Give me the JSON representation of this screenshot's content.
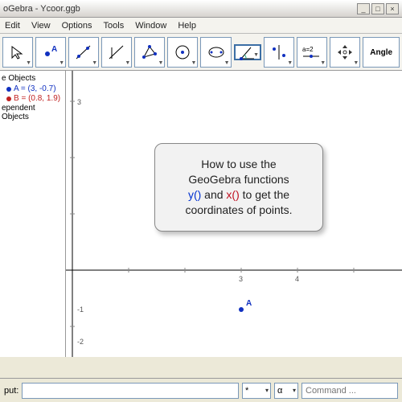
{
  "window": {
    "title": "oGebra - Ycoor.ggb"
  },
  "menu": {
    "edit": "Edit",
    "view": "View",
    "options": "Options",
    "tools": "Tools",
    "window": "Window",
    "help": "Help"
  },
  "toolbar": {
    "angle": "Angle"
  },
  "algebra": {
    "free_header": "e Objects",
    "objA": "A = (3, -0.7)",
    "objB": "B = (0.8, 1.9)",
    "dep_header": "ependent Objects"
  },
  "tooltip": {
    "l1": "How to use the",
    "l2": "GeoGebra functions",
    "yfn": "y()",
    "and": " and ",
    "xfn": "x()",
    "l3b": " to get the",
    "l4": "coordinates of points."
  },
  "point": {
    "label": "A"
  },
  "axis": {
    "t3": "3",
    "t4": "4",
    "tn1": "-1",
    "tn2": "-2",
    "ty3": "3"
  },
  "inputbar": {
    "label": "put:",
    "sym": "*",
    "alpha": "α",
    "cmd_placeholder": "Command ..."
  },
  "chart_data": {
    "type": "scatter",
    "title": "",
    "xlabel": "",
    "ylabel": "",
    "xlim": [
      -1,
      6
    ],
    "ylim": [
      -3,
      4
    ],
    "series": [
      {
        "name": "A",
        "values": [
          [
            3,
            -0.7
          ]
        ]
      },
      {
        "name": "B",
        "values": [
          [
            0.8,
            1.9
          ]
        ]
      }
    ]
  }
}
